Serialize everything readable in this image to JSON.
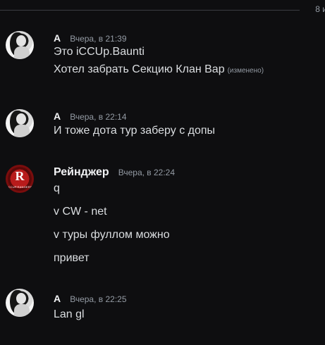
{
  "divider": {
    "label": "8 и"
  },
  "messages": [
    {
      "author": "A",
      "time": "Вчера, в 21:39",
      "lines": [
        "Это iCCUp.Baunti",
        "Хотел забрать Секцию Клан Вар"
      ],
      "edited_label": "(изменено)",
      "avatar": "girl-avatar"
    },
    {
      "author": "A",
      "time": "Вчера, в 22:14",
      "lines": [
        "И тоже дота тур заберу с допы"
      ],
      "avatar": "girl-avatar"
    },
    {
      "author": "Рейнджер",
      "time": "Вчера, в 22:24",
      "lines": [
        "q",
        "v CW - net",
        "v туры фуллом можно",
        "привет"
      ],
      "avatar": "iccup-rangers-logo",
      "logo_letter": "R",
      "logo_caption": "ICCUP.RANGERS"
    },
    {
      "author": "A",
      "time": "Вчера, в 22:25",
      "lines": [
        "Lan gl"
      ],
      "avatar": "girl-avatar"
    }
  ]
}
